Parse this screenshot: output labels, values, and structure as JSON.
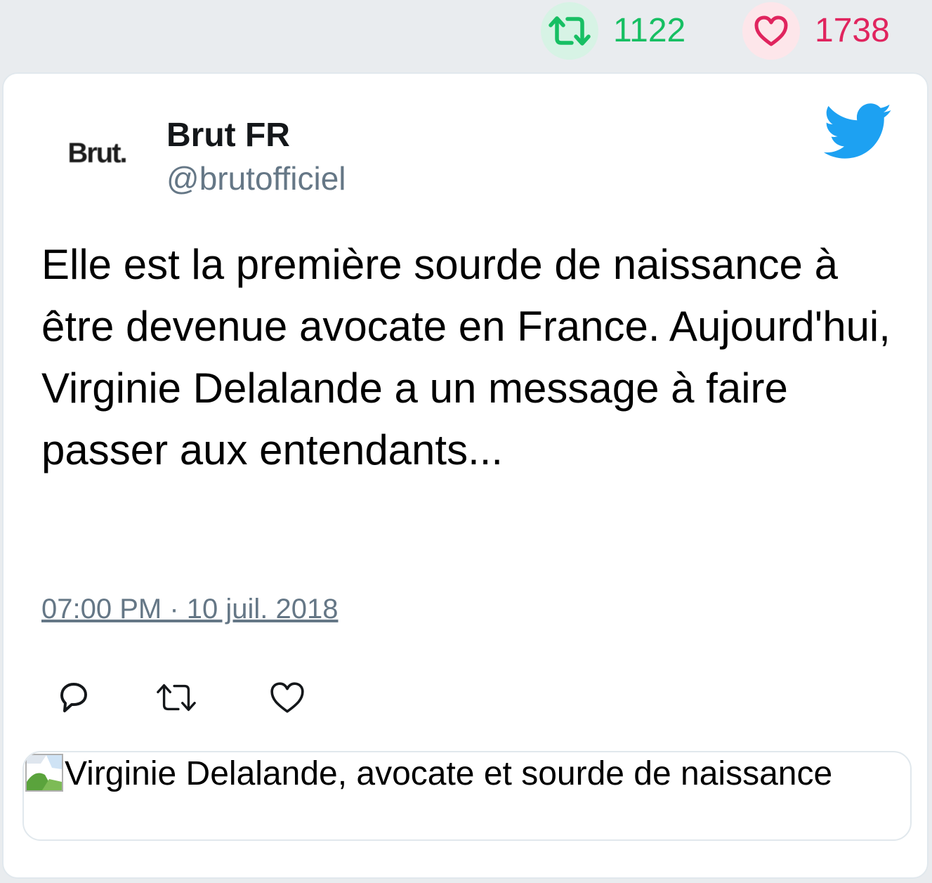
{
  "stats": {
    "retweet_count": "1122",
    "like_count": "1738",
    "retweet_color": "#17bf63",
    "like_color": "#e0245e"
  },
  "tweet": {
    "avatar_text": "Brut.",
    "author_name": "Brut FR",
    "author_handle": "@brutofficiel",
    "text": "Elle est la première sourde de naissance à être devenue avocate en France. Aujourd'hui, Virginie Delalande a un message à faire passer aux entendants...",
    "timestamp": "07:00 PM · 10 juil. 2018",
    "media_alt": "Virginie Delalande, avocate et sourde de naissance"
  },
  "icons": {
    "brand": "twitter-bird-icon",
    "reply": "reply-icon",
    "retweet": "retweet-icon",
    "like": "heart-icon"
  },
  "colors": {
    "twitter_blue": "#1da1f2",
    "muted_text": "#657786"
  }
}
